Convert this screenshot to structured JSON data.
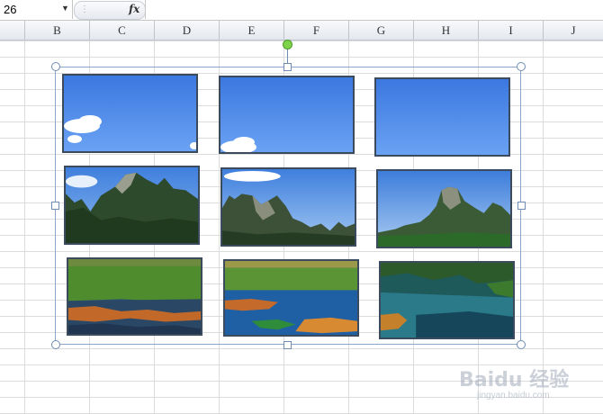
{
  "formula_bar": {
    "name_box": "26",
    "fx_label": "fx",
    "formula_value": ""
  },
  "columns": [
    "B",
    "C",
    "D",
    "E",
    "F",
    "G",
    "H",
    "I",
    "J"
  ],
  "watermark": {
    "brand": "Baidu 经验",
    "url": "jingyan.baidu.com"
  },
  "photos": [
    {
      "scene": "sky-clouds-left"
    },
    {
      "scene": "sky-clouds-bottom"
    },
    {
      "scene": "sky-plain"
    },
    {
      "scene": "karst-mountains"
    },
    {
      "scene": "karst-peaks-clouds"
    },
    {
      "scene": "karst-river-valley"
    },
    {
      "scene": "river-grass-field"
    },
    {
      "scene": "river-bank-field"
    },
    {
      "scene": "river-bend"
    }
  ]
}
